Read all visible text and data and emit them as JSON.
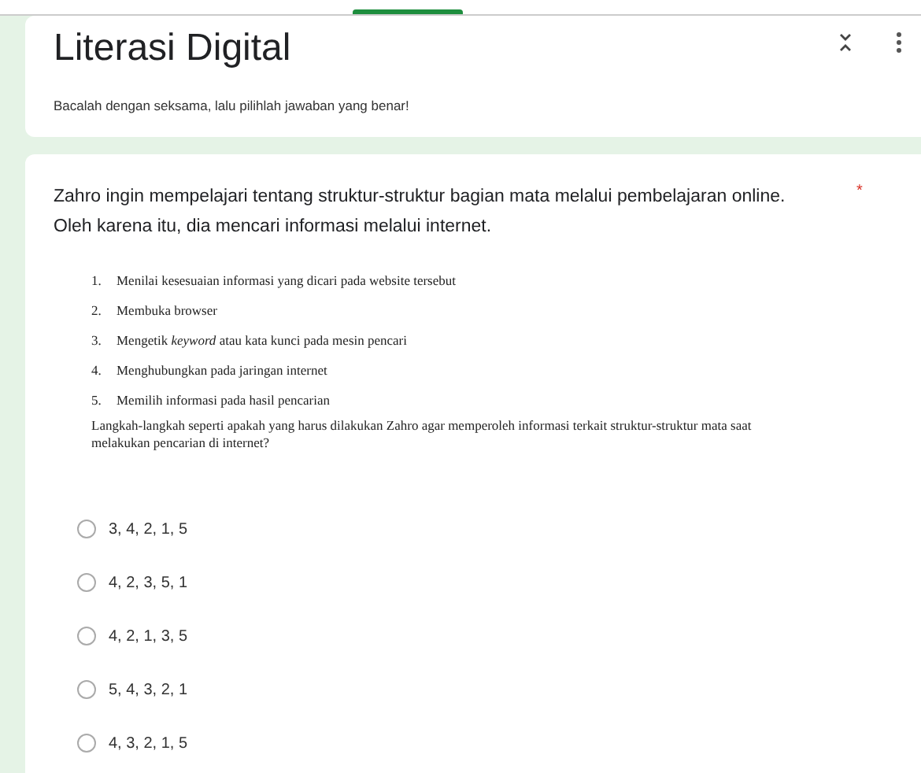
{
  "form": {
    "title": "Literasi Digital",
    "description": "Bacalah dengan seksama, lalu pilihlah jawaban yang benar!"
  },
  "question": {
    "text": "Zahro ingin mempelajari tentang struktur-struktur bagian mata melalui pembelajaran online. Oleh karena itu, dia mencari informasi melalui internet.",
    "required_mark": "*",
    "steps": [
      {
        "number": "1.",
        "text": "Menilai kesesuaian informasi yang dicari pada website tersebut"
      },
      {
        "number": "2.",
        "text": "Membuka browser"
      },
      {
        "number": "3.",
        "text": "Mengetik *keyword* atau kata kunci pada mesin pencari"
      },
      {
        "number": "4.",
        "text": "Menghubungkan pada jaringan internet"
      },
      {
        "number": "5.",
        "text": "Memilih informasi pada hasil pencarian"
      }
    ],
    "prompt": "Langkah-langkah seperti apakah yang harus dilakukan Zahro agar memperoleh informasi terkait struktur-struktur mata saat melakukan pencarian di internet?",
    "options": [
      {
        "label": "3, 4, 2, 1, 5",
        "selected": false
      },
      {
        "label": "4, 2, 3, 5, 1",
        "selected": false
      },
      {
        "label": "4, 2, 1, 3, 5",
        "selected": false
      },
      {
        "label": "5, 4, 3, 2, 1",
        "selected": false
      },
      {
        "label": "4, 3, 2, 1, 5",
        "selected": false
      }
    ]
  }
}
